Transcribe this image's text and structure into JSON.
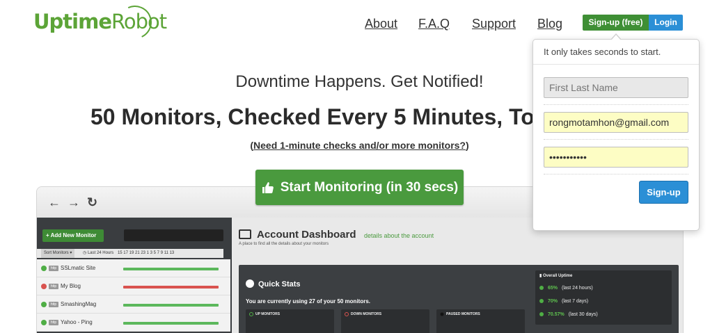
{
  "logo": {
    "part1": "Uptime",
    "part2": "Robot"
  },
  "nav": {
    "about": "About",
    "faq": "F.A.Q",
    "support": "Support",
    "blog": "Blog"
  },
  "auth": {
    "signup": "Sign-up (free)",
    "login": "Login"
  },
  "hero": {
    "tagline": "Downtime Happens. Get Notified!",
    "headline": "50 Monitors, Checked Every 5 Minutes, Tot",
    "need_link": "Need 1-minute checks and/or more monitors?",
    "start_button": "Start Monitoring (in 30 secs)"
  },
  "signup_popover": {
    "heading": "It only takes seconds to start.",
    "name_placeholder": "First Last Name",
    "email_value": "rongmotamhon@gmail.com",
    "password_value": "•••••••••••",
    "submit": "Sign-up"
  },
  "preview": {
    "add_monitor": "+ Add New Monitor",
    "sort_label": "Sort Monitors ▾",
    "last24": "Last 24 Hours",
    "hours": "15  17  19  21  23  1  3  5  7  9  11  13",
    "monitors": [
      {
        "name": "SSLmatic Site",
        "status": "up",
        "badge": "http"
      },
      {
        "name": "My Blog",
        "status": "down",
        "badge": "http"
      },
      {
        "name": "SmashingMag",
        "status": "up",
        "badge": "http"
      },
      {
        "name": "Yahoo - Ping",
        "status": "up",
        "badge": "http"
      }
    ],
    "dashboard_title": "Account Dashboard",
    "dashboard_sub": "details about the account",
    "dashboard_hint": "A place to find all the details about your monitors",
    "quick_stats": "Quick Stats",
    "usage_text": "You are currently using 27 of your 50 monitors.",
    "up_monitors": "UP MONITORS",
    "down_monitors": "DOWN MONITORS",
    "paused_monitors": "PAUSED MONITORS",
    "overall_uptime": "Overall Uptime",
    "uptime": [
      {
        "pct": "65%",
        "period": "(last 24 hours)"
      },
      {
        "pct": "70%",
        "period": "(last 7 days)"
      },
      {
        "pct": "70.57%",
        "period": "(last 30 days)"
      }
    ]
  },
  "colors": {
    "green": "#4a9a3e",
    "blue": "#2b8fd6",
    "red": "#d9534f"
  }
}
